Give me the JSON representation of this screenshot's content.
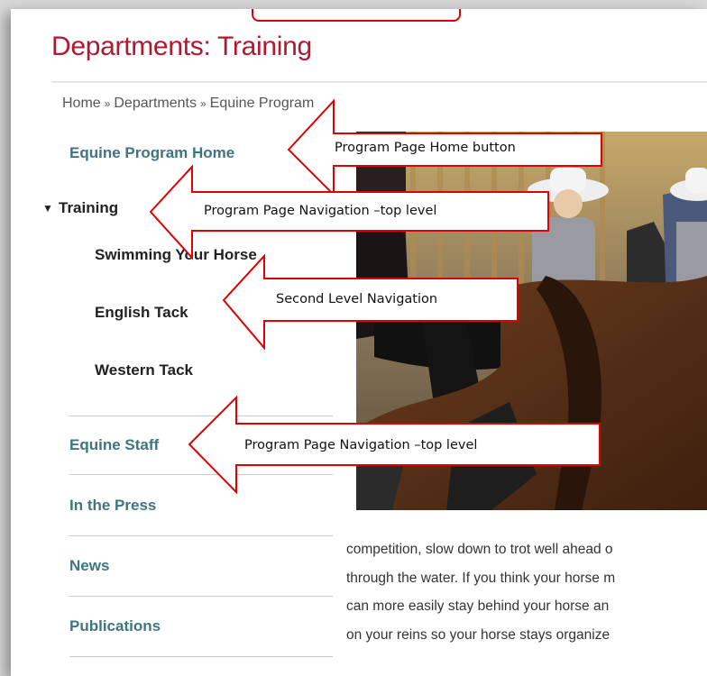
{
  "page_title": "Departments: Training",
  "breadcrumb": {
    "items": [
      "Home",
      "Departments",
      "Equine Program"
    ],
    "separator": "»"
  },
  "sidebar": {
    "home_label": "Equine Program Home",
    "current_label": "Training",
    "sub_items": [
      "Swimming Your Horse",
      "English Tack",
      "Western Tack"
    ],
    "items": [
      "Equine Staff",
      "In the Press",
      "News",
      "Publications"
    ]
  },
  "content": {
    "lines": [
      "competition, slow down to trot well ahead o",
      "through the water. If you think your horse m",
      "can more easily stay behind your horse an",
      "on your reins so your horse stays organize"
    ]
  },
  "callouts": [
    {
      "label": "Program Page Home button"
    },
    {
      "label": "Program Page Navigation –top level"
    },
    {
      "label": "Second Level Navigation"
    },
    {
      "label": "Program Page Navigation –top level"
    }
  ],
  "colors": {
    "title": "#b3172f",
    "nav_link": "#3f7580",
    "callout_border": "#e00000"
  }
}
